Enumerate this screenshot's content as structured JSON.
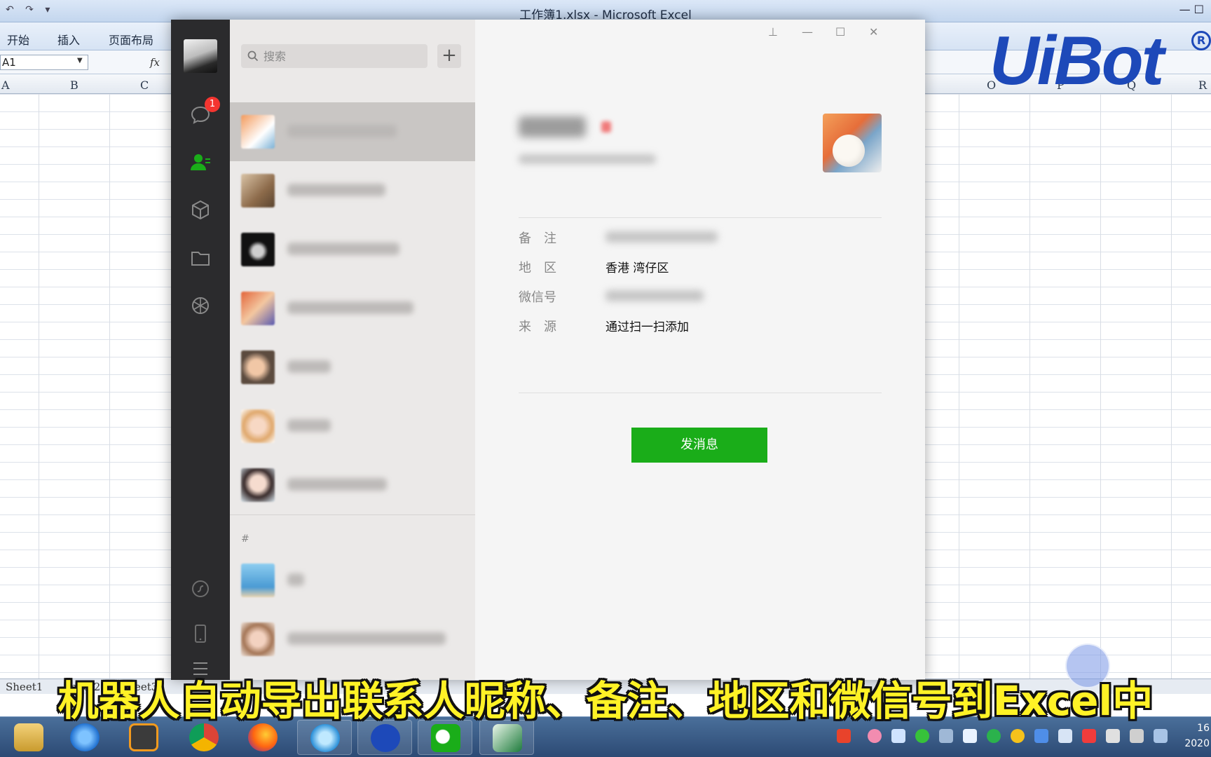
{
  "excel": {
    "window_title": "工作簿1.xlsx - Microsoft Excel",
    "ribbon_tabs": [
      "开始",
      "插入",
      "页面布局"
    ],
    "name_box": "A1",
    "fx_label": "fx",
    "columns_left": [
      "A",
      "B",
      "C"
    ],
    "columns_right": [
      "O",
      "P",
      "Q",
      "R"
    ],
    "sheet_tabs": [
      "Sheet1",
      "Sheet2",
      "Sheet3"
    ]
  },
  "logo": {
    "text": "UiBot",
    "reg_mark": "R"
  },
  "wechat": {
    "search": {
      "placeholder": "搜索"
    },
    "add_button": "+",
    "unread_badge": "1",
    "group_letter": "#",
    "window_controls": {
      "pin": "⊥",
      "minimize": "—",
      "maximize": "☐",
      "close": "✕"
    },
    "profile": {
      "fields": [
        {
          "label": "备　注",
          "value": ""
        },
        {
          "label": "地　区",
          "value": "香港 湾仔区"
        },
        {
          "label": "微信号",
          "value": ""
        },
        {
          "label": "来　源",
          "value": "通过扫一扫添加"
        }
      ],
      "send_button": "发消息"
    }
  },
  "subtitle": "机器人自动导出联系人昵称、备注、地区和微信号到Excel中",
  "taskbar": {
    "clock_line1": "16",
    "clock_line2": "2020"
  }
}
